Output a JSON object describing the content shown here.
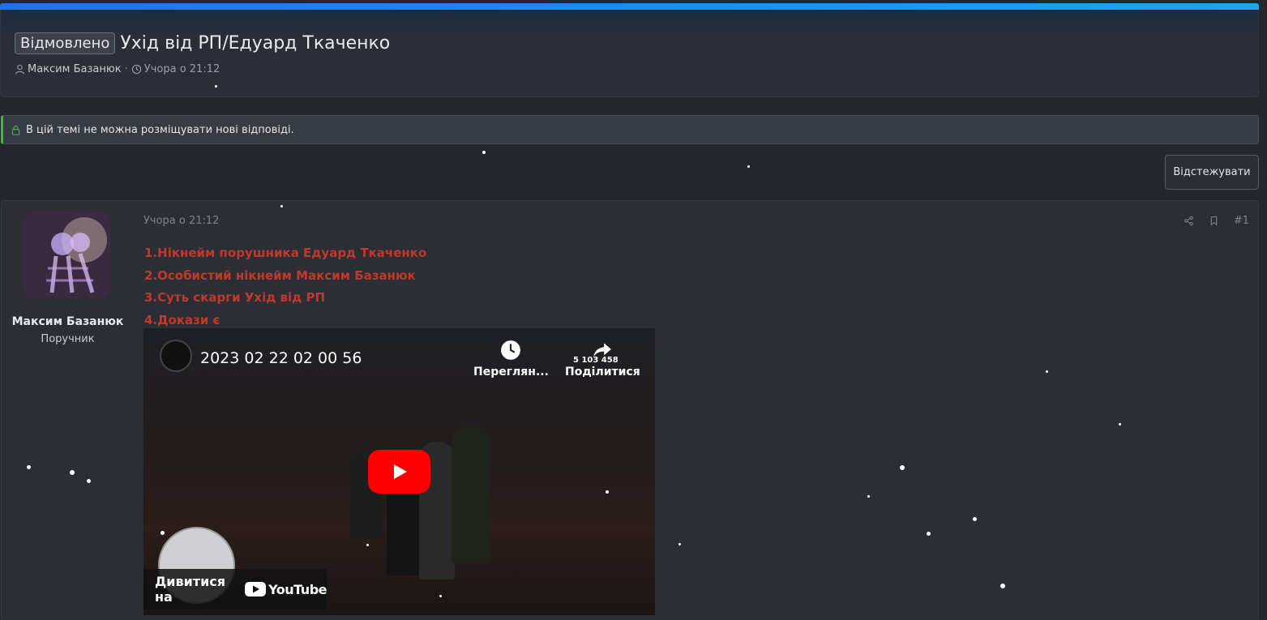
{
  "thread": {
    "status_badge": "Відмовлено",
    "title": "Ухід від РП/Едуард Ткаченко",
    "author": "Максим Базанюк",
    "separator": "·",
    "time": "Учора о 21:12"
  },
  "notice": {
    "text": "В цій темі не можна розміщувати нові відповіді."
  },
  "toolbar": {
    "follow_label": "Відстежувати"
  },
  "post": {
    "time": "Учора о 21:12",
    "number": "#1",
    "user": {
      "name": "Максим Базанюк",
      "role": "Поручник"
    },
    "lines": [
      "1.Нікнейм порушника Едуард Ткаченко",
      "2.Особистий нікнейм Максим Базанюк",
      "3.Суть скарги Ухід від РП",
      "4.Докази є"
    ],
    "video": {
      "title": "2023 02 22 02 00 56",
      "watch_later": "Переглян...",
      "share": "Поділитися",
      "watch_on": "Дивитися на",
      "platform": "YouTube",
      "hud_money": "5 103 458"
    }
  },
  "colors": {
    "accent": "#1e74e6",
    "post_text": "#c0392b",
    "notice_border": "#4caf50",
    "youtube_red": "#ff0000"
  }
}
